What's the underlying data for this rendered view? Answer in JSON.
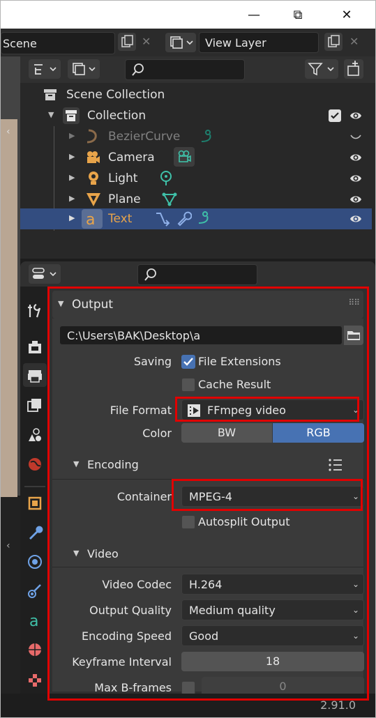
{
  "window": {
    "minimize": "—",
    "maximize": "⧉",
    "close": "✕"
  },
  "top_header": {
    "scene_label": "Scene",
    "view_layer_label": "View Layer"
  },
  "outliner": {
    "scene_collection": "Scene Collection",
    "collection": "Collection",
    "items": [
      {
        "label": "BezierCurve",
        "dim": true
      },
      {
        "label": "Camera"
      },
      {
        "label": "Light"
      },
      {
        "label": "Plane"
      },
      {
        "label": "Text",
        "selected": true
      }
    ]
  },
  "output_panel": {
    "title": "Output",
    "path": "C:\\Users\\BAK\\Desktop\\a",
    "saving_label": "Saving",
    "file_extensions": "File Extensions",
    "cache_result": "Cache Result",
    "file_format_label": "File Format",
    "file_format_value": "FFmpeg video",
    "color_label": "Color",
    "color_bw": "BW",
    "color_rgb": "RGB"
  },
  "encoding": {
    "title": "Encoding",
    "container_label": "Container",
    "container_value": "MPEG-4",
    "autosplit": "Autosplit Output"
  },
  "video": {
    "title": "Video",
    "codec_label": "Video Codec",
    "codec_value": "H.264",
    "quality_label": "Output Quality",
    "quality_value": "Medium quality",
    "speed_label": "Encoding Speed",
    "speed_value": "Good",
    "keyframe_label": "Keyframe Interval",
    "keyframe_value": "18",
    "bframes_label": "Max B-frames",
    "bframes_value": "0"
  },
  "status": {
    "version": "2.91.0"
  },
  "colors": {
    "selection": "#334d80",
    "accent": "#4772b3",
    "highlight_box": "#e10000",
    "text_orange": "#e8a44a"
  }
}
